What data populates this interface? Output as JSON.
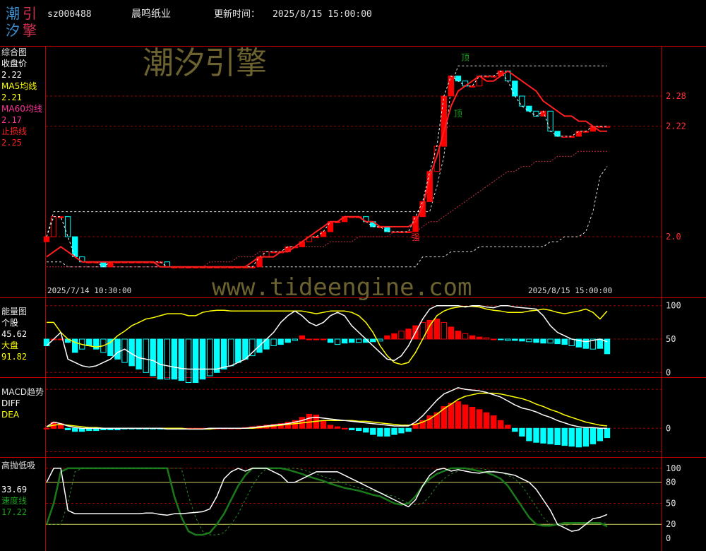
{
  "header": {
    "logo_chars": [
      "潮",
      "引",
      "汐",
      "擎"
    ],
    "code": "sz000488",
    "name": "晨鸣纸业",
    "update_label": "更新时间：",
    "update_time": "2025/8/15 15:00:00"
  },
  "watermark": {
    "brand": "潮汐引擎",
    "url": "www.tideengine.com"
  },
  "colors": {
    "up": "#ff0000",
    "down": "#00ffff",
    "white": "#ffffff",
    "yellow": "#ffff00",
    "red_line": "#ff2020",
    "green": "#1a7a1a"
  },
  "chart_data": [
    {
      "panel": "price",
      "type": "candlestick",
      "title": "综合图",
      "legend": [
        {
          "label": "收盘价",
          "value": "2.22",
          "color": "#ffffff"
        },
        {
          "label": "MA5均线",
          "value": "2.21",
          "color": "#ffff00"
        },
        {
          "label": "MA60均线",
          "value": "2.17",
          "color": "#ff3399"
        },
        {
          "label": "止损线",
          "value": "2.25",
          "color": "#ff2020"
        }
      ],
      "y_ticks": [
        "2.28",
        "2.22",
        "2.0"
      ],
      "y_tick_values": [
        2.28,
        2.22,
        2.0
      ],
      "ylim": [
        1.92,
        2.37
      ],
      "x_start_label": "2025/7/14 10:30:00",
      "x_end_label": "2025/8/15 15:00:00",
      "markers": [
        {
          "text": "顶",
          "index": 59,
          "color": "#1aa01a"
        },
        {
          "text": "顶",
          "index": 58,
          "color": "#1aa01a"
        },
        {
          "text": "强",
          "index": 52,
          "color": "#ff2020"
        }
      ],
      "closes": [
        2.0,
        2.04,
        2.04,
        2.0,
        1.96,
        1.95,
        1.95,
        1.95,
        1.94,
        1.95,
        1.95,
        1.95,
        1.95,
        1.95,
        1.95,
        1.95,
        1.95,
        1.94,
        1.94,
        1.94,
        1.94,
        1.94,
        1.94,
        1.94,
        1.94,
        1.94,
        1.94,
        1.94,
        1.94,
        1.94,
        1.96,
        1.97,
        1.97,
        1.97,
        1.98,
        1.98,
        1.99,
        2.0,
        2.0,
        2.01,
        2.03,
        2.03,
        2.04,
        2.04,
        2.04,
        2.03,
        2.02,
        2.02,
        2.01,
        2.01,
        2.01,
        2.01,
        2.04,
        2.07,
        2.13,
        2.18,
        2.28,
        2.32,
        2.31,
        2.3,
        2.3,
        2.32,
        2.32,
        2.32,
        2.33,
        2.31,
        2.28,
        2.26,
        2.25,
        2.24,
        2.25,
        2.21,
        2.2,
        2.2,
        2.2,
        2.21,
        2.21,
        2.22,
        2.22,
        2.22
      ],
      "ma_red": [
        1.96,
        1.97,
        1.98,
        1.97,
        1.96,
        1.95,
        1.95,
        1.95,
        1.95,
        1.95,
        1.95,
        1.95,
        1.95,
        1.95,
        1.95,
        1.95,
        1.94,
        1.94,
        1.94,
        1.94,
        1.94,
        1.94,
        1.94,
        1.94,
        1.94,
        1.94,
        1.94,
        1.94,
        1.94,
        1.95,
        1.96,
        1.96,
        1.96,
        1.97,
        1.97,
        1.98,
        1.99,
        2.0,
        2.01,
        2.02,
        2.03,
        2.03,
        2.04,
        2.04,
        2.04,
        2.03,
        2.03,
        2.02,
        2.02,
        2.02,
        2.02,
        2.02,
        2.03,
        2.06,
        2.12,
        2.16,
        2.21,
        2.26,
        2.29,
        2.3,
        2.31,
        2.32,
        2.31,
        2.31,
        2.32,
        2.33,
        2.32,
        2.31,
        2.3,
        2.29,
        2.27,
        2.26,
        2.25,
        2.24,
        2.24,
        2.23,
        2.23,
        2.22,
        2.21,
        2.21
      ],
      "ma60": [
        1.94,
        1.94,
        1.94,
        1.94,
        1.94,
        1.94,
        1.94,
        1.94,
        1.94,
        1.94,
        1.94,
        1.94,
        1.94,
        1.94,
        1.94,
        1.94,
        1.94,
        1.94,
        1.94,
        1.94,
        1.94,
        1.94,
        1.94,
        1.95,
        1.95,
        1.95,
        1.95,
        1.96,
        1.96,
        1.96,
        1.97,
        1.97,
        1.97,
        1.97,
        1.98,
        1.98,
        1.98,
        1.98,
        1.98,
        1.98,
        1.99,
        1.99,
        1.99,
        1.99,
        2.0,
        2.0,
        2.0,
        2.0,
        2.0,
        2.01,
        2.01,
        2.01,
        2.01,
        2.02,
        2.03,
        2.03,
        2.04,
        2.05,
        2.06,
        2.07,
        2.08,
        2.09,
        2.1,
        2.11,
        2.12,
        2.13,
        2.13,
        2.14,
        2.14,
        2.15,
        2.15,
        2.15,
        2.16,
        2.16,
        2.16,
        2.17,
        2.17,
        2.17,
        2.17,
        2.17
      ],
      "upper_band": [
        2.0,
        2.05,
        2.05,
        2.05,
        2.05,
        2.05,
        2.05,
        2.05,
        2.05,
        2.05,
        2.05,
        2.05,
        2.05,
        2.05,
        2.05,
        2.05,
        2.05,
        2.05,
        2.05,
        2.05,
        2.05,
        2.05,
        2.05,
        2.05,
        2.05,
        2.05,
        2.05,
        2.05,
        2.05,
        2.05,
        2.05,
        2.05,
        2.05,
        2.05,
        2.05,
        2.05,
        2.05,
        2.05,
        2.05,
        2.05,
        2.05,
        2.05,
        2.05,
        2.05,
        2.05,
        2.05,
        2.05,
        2.05,
        2.05,
        2.05,
        2.05,
        2.05,
        2.05,
        2.05,
        2.05,
        2.1,
        2.16,
        2.3,
        2.34,
        2.34,
        2.34,
        2.34,
        2.34,
        2.34,
        2.34,
        2.34,
        2.34,
        2.34,
        2.34,
        2.34,
        2.34,
        2.34,
        2.34,
        2.34,
        2.34,
        2.34,
        2.34,
        2.34,
        2.34,
        2.34
      ],
      "lower_band": [
        1.95,
        1.95,
        1.95,
        1.94,
        1.94,
        1.94,
        1.94,
        1.94,
        1.94,
        1.94,
        1.94,
        1.94,
        1.94,
        1.94,
        1.94,
        1.94,
        1.94,
        1.94,
        1.94,
        1.94,
        1.94,
        1.94,
        1.94,
        1.94,
        1.94,
        1.94,
        1.94,
        1.94,
        1.94,
        1.94,
        1.94,
        1.94,
        1.94,
        1.94,
        1.94,
        1.94,
        1.94,
        1.94,
        1.94,
        1.94,
        1.94,
        1.94,
        1.94,
        1.94,
        1.94,
        1.94,
        1.94,
        1.94,
        1.94,
        1.94,
        1.94,
        1.94,
        1.94,
        1.96,
        1.96,
        1.96,
        1.96,
        1.97,
        1.97,
        1.97,
        1.97,
        1.98,
        1.98,
        1.98,
        1.98,
        1.98,
        1.98,
        1.98,
        1.98,
        1.98,
        1.98,
        1.99,
        1.99,
        2.0,
        2.0,
        2.0,
        2.01,
        2.05,
        2.12,
        2.14
      ]
    },
    {
      "panel": "energy",
      "type": "bar+line",
      "title": "能量图",
      "legend": [
        {
          "label": "个股",
          "value": "45.62",
          "color": "#ffffff"
        },
        {
          "label": "大盘",
          "value": "91.82",
          "color": "#ffff00"
        }
      ],
      "y_ticks": [
        "100",
        "50",
        "0"
      ],
      "y_tick_values": [
        100,
        50,
        0
      ],
      "ylim": [
        -5,
        105
      ],
      "stock": [
        40,
        50,
        60,
        20,
        15,
        10,
        8,
        10,
        15,
        20,
        30,
        35,
        28,
        22,
        20,
        18,
        12,
        10,
        8,
        6,
        5,
        5,
        5,
        5,
        5,
        8,
        10,
        15,
        20,
        30,
        40,
        50,
        60,
        75,
        85,
        92,
        85,
        75,
        70,
        75,
        85,
        90,
        85,
        70,
        60,
        50,
        40,
        30,
        20,
        18,
        25,
        40,
        60,
        80,
        95,
        100,
        100,
        100,
        100,
        98,
        100,
        100,
        98,
        97,
        100,
        100,
        98,
        97,
        96,
        95,
        85,
        70,
        60,
        55,
        50,
        48,
        46,
        48,
        50,
        46
      ],
      "market": [
        75,
        75,
        60,
        50,
        45,
        42,
        40,
        38,
        40,
        45,
        55,
        62,
        70,
        75,
        80,
        82,
        85,
        88,
        88,
        88,
        85,
        85,
        90,
        92,
        93,
        93,
        92,
        92,
        92,
        92,
        92,
        92,
        92,
        92,
        92,
        92,
        92,
        90,
        88,
        90,
        92,
        92,
        92,
        90,
        85,
        75,
        60,
        40,
        25,
        15,
        12,
        15,
        30,
        50,
        70,
        85,
        92,
        96,
        98,
        99,
        99,
        98,
        95,
        93,
        92,
        90,
        90,
        90,
        92,
        93,
        95,
        93,
        90,
        88,
        90,
        92,
        95,
        90,
        80,
        92
      ],
      "bars": [
        -10,
        0,
        0,
        -5,
        -20,
        -15,
        -10,
        -15,
        -20,
        -25,
        -30,
        -35,
        -40,
        -45,
        -50,
        -55,
        -60,
        -60,
        -60,
        -62,
        -65,
        -65,
        -60,
        -55,
        -50,
        -45,
        -40,
        -35,
        -30,
        -25,
        -20,
        -15,
        -10,
        -8,
        -5,
        -2,
        5,
        0,
        0,
        0,
        -5,
        -8,
        -6,
        -5,
        -5,
        -5,
        -4,
        -3,
        5,
        8,
        12,
        15,
        20,
        25,
        28,
        30,
        25,
        18,
        12,
        8,
        5,
        3,
        2,
        0,
        -1,
        -2,
        -2,
        -3,
        -4,
        -5,
        -6,
        -6,
        -7,
        -8,
        -10,
        -12,
        -14,
        -15,
        -14,
        -22
      ]
    },
    {
      "panel": "macd",
      "type": "bar+line",
      "title": "MACD趋势",
      "legend": [
        {
          "label": "DIFF",
          "value": "",
          "color": "#ffffff"
        },
        {
          "label": "DEA",
          "value": "",
          "color": "#ffff00"
        }
      ],
      "y_ticks": [
        "0"
      ],
      "y_tick_values": [
        0
      ],
      "ylim": [
        -0.035,
        0.06
      ],
      "diff": [
        0.002,
        0.008,
        0.006,
        0.003,
        0.001,
        0.0,
        0.0,
        0.0,
        0.0,
        0.0,
        0.0,
        0.0,
        0.0,
        0.0,
        0.0,
        0.0,
        0.0,
        -0.001,
        -0.001,
        -0.001,
        -0.001,
        -0.001,
        -0.001,
        0.0,
        0.0,
        0.0,
        0.0,
        0.0,
        0.0,
        0.001,
        0.002,
        0.003,
        0.004,
        0.005,
        0.006,
        0.008,
        0.01,
        0.013,
        0.014,
        0.013,
        0.012,
        0.011,
        0.01,
        0.009,
        0.008,
        0.007,
        0.006,
        0.005,
        0.004,
        0.003,
        0.003,
        0.003,
        0.008,
        0.016,
        0.026,
        0.036,
        0.044,
        0.048,
        0.052,
        0.05,
        0.049,
        0.048,
        0.046,
        0.043,
        0.04,
        0.035,
        0.03,
        0.026,
        0.024,
        0.021,
        0.017,
        0.014,
        0.01,
        0.007,
        0.004,
        0.002,
        0.001,
        0.001,
        0.0,
        0.0
      ],
      "dea": [
        0.002,
        0.004,
        0.005,
        0.004,
        0.003,
        0.002,
        0.001,
        0.001,
        0.0,
        0.0,
        0.0,
        0.0,
        0.0,
        0.0,
        0.0,
        0.0,
        0.0,
        0.0,
        0.0,
        0.0,
        -0.001,
        -0.001,
        -0.001,
        -0.001,
        0.0,
        0.0,
        0.0,
        0.0,
        0.0,
        0.0,
        0.001,
        0.002,
        0.003,
        0.004,
        0.005,
        0.006,
        0.007,
        0.008,
        0.009,
        0.01,
        0.01,
        0.01,
        0.01,
        0.01,
        0.009,
        0.009,
        0.008,
        0.007,
        0.006,
        0.005,
        0.004,
        0.004,
        0.005,
        0.008,
        0.012,
        0.018,
        0.025,
        0.031,
        0.037,
        0.041,
        0.043,
        0.045,
        0.045,
        0.045,
        0.044,
        0.042,
        0.04,
        0.038,
        0.035,
        0.031,
        0.028,
        0.024,
        0.021,
        0.017,
        0.014,
        0.011,
        0.008,
        0.006,
        0.004,
        0.003
      ],
      "bars": [
        0,
        0.008,
        0.006,
        -0.002,
        -0.004,
        -0.004,
        -0.003,
        -0.003,
        -0.002,
        -0.002,
        -0.002,
        -0.001,
        -0.001,
        -0.001,
        -0.001,
        -0.001,
        -0.001,
        -0.001,
        0,
        0,
        0,
        0,
        0,
        0,
        0,
        0,
        0,
        0,
        0.001,
        0.002,
        0.003,
        0.004,
        0.005,
        0.006,
        0.008,
        0.01,
        0.014,
        0.018,
        0.017,
        0.01,
        0.004,
        0.002,
        0,
        -0.002,
        -0.003,
        -0.005,
        -0.008,
        -0.01,
        -0.01,
        -0.008,
        -0.006,
        -0.004,
        0.006,
        0.01,
        0.016,
        0.02,
        0.028,
        0.032,
        0.034,
        0.03,
        0.027,
        0.024,
        0.02,
        0.016,
        0.01,
        0.004,
        -0.004,
        -0.01,
        -0.016,
        -0.018,
        -0.019,
        -0.02,
        -0.021,
        -0.022,
        -0.023,
        -0.024,
        -0.023,
        -0.02,
        -0.016,
        -0.012
      ]
    },
    {
      "panel": "oscillator",
      "type": "line",
      "title": "高抛低吸",
      "legend": [
        {
          "label": "",
          "value": "33.69",
          "color": "#ffffff"
        },
        {
          "label": "速度线",
          "value": "17.22",
          "color": "#1aa01a"
        }
      ],
      "y_ticks": [
        "100",
        "80",
        "50",
        "20",
        "0"
      ],
      "y_tick_values": [
        100,
        80,
        50,
        20,
        0
      ],
      "ylim": [
        -2,
        108
      ],
      "white": [
        80,
        100,
        100,
        40,
        35,
        35,
        35,
        35,
        35,
        35,
        35,
        35,
        35,
        35,
        36,
        36,
        34,
        33,
        35,
        35,
        36,
        37,
        38,
        42,
        60,
        85,
        95,
        100,
        96,
        100,
        100,
        100,
        95,
        90,
        80,
        80,
        85,
        90,
        95,
        95,
        95,
        95,
        90,
        85,
        80,
        75,
        70,
        65,
        60,
        55,
        50,
        45,
        55,
        75,
        90,
        98,
        100,
        96,
        98,
        96,
        94,
        93,
        95,
        95,
        94,
        92,
        90,
        85,
        80,
        70,
        55,
        40,
        20,
        15,
        10,
        12,
        20,
        28,
        30,
        34
      ],
      "green": [
        20,
        50,
        95,
        100,
        100,
        100,
        100,
        100,
        100,
        100,
        100,
        100,
        100,
        100,
        100,
        100,
        100,
        100,
        60,
        30,
        10,
        5,
        5,
        8,
        20,
        35,
        55,
        75,
        90,
        100,
        100,
        100,
        100,
        100,
        98,
        95,
        92,
        88,
        85,
        82,
        78,
        75,
        72,
        70,
        68,
        65,
        62,
        60,
        55,
        50,
        48,
        50,
        60,
        75,
        85,
        92,
        96,
        100,
        100,
        100,
        98,
        96,
        94,
        90,
        85,
        75,
        60,
        45,
        30,
        20,
        18,
        18,
        20,
        22,
        22,
        22,
        22,
        22,
        22,
        17
      ]
    }
  ]
}
